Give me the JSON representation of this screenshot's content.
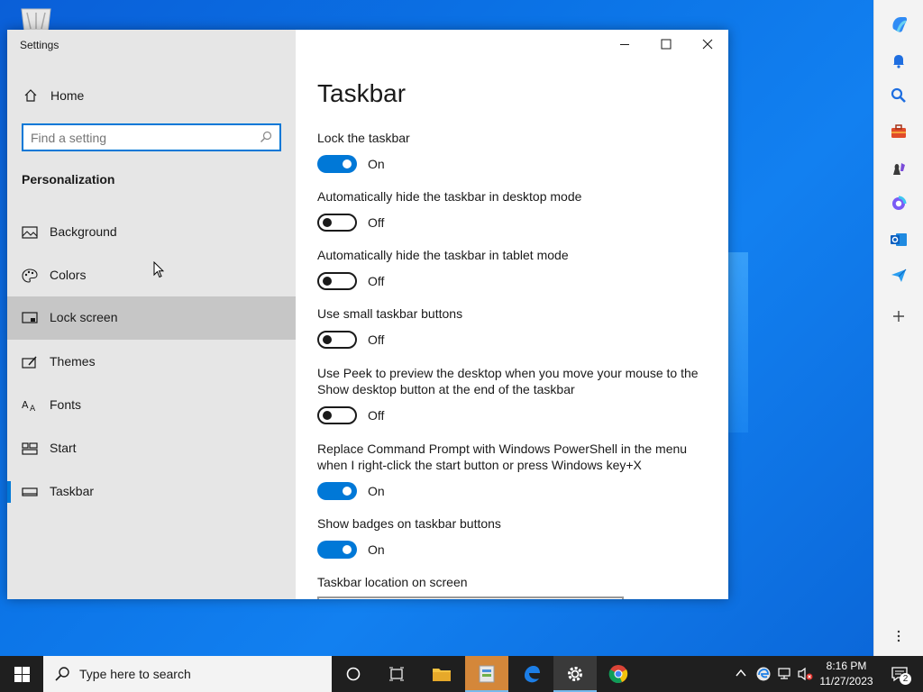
{
  "window": {
    "title": "Settings"
  },
  "nav": {
    "home_label": "Home",
    "search_placeholder": "Find a setting",
    "section_heading": "Personalization",
    "items": [
      {
        "label": "Background",
        "icon": "image-icon"
      },
      {
        "label": "Colors",
        "icon": "palette-icon"
      },
      {
        "label": "Lock screen",
        "icon": "lock-screen-icon"
      },
      {
        "label": "Themes",
        "icon": "themes-icon"
      },
      {
        "label": "Fonts",
        "icon": "fonts-icon"
      },
      {
        "label": "Start",
        "icon": "start-icon"
      },
      {
        "label": "Taskbar",
        "icon": "taskbar-icon"
      }
    ],
    "hovered_item": "Lock screen",
    "selected_item": "Taskbar"
  },
  "content": {
    "title": "Taskbar",
    "settings": [
      {
        "desc": "Lock the taskbar",
        "state": "On"
      },
      {
        "desc": "Automatically hide the taskbar in desktop mode",
        "state": "Off"
      },
      {
        "desc": "Automatically hide the taskbar in tablet mode",
        "state": "Off"
      },
      {
        "desc": "Use small taskbar buttons",
        "state": "Off"
      },
      {
        "desc": "Use Peek to preview the desktop when you move your mouse to the Show desktop button at the end of the taskbar",
        "state": "Off"
      },
      {
        "desc": "Replace Command Prompt with Windows PowerShell in the menu when I right-click the start button or press Windows key+X",
        "state": "On"
      },
      {
        "desc": "Show badges on taskbar buttons",
        "state": "On"
      }
    ],
    "location_label": "Taskbar location on screen"
  },
  "taskbar": {
    "search_text": "Type here to search",
    "time": "8:16 PM",
    "date": "11/27/2023",
    "notification_count": "2"
  },
  "colors": {
    "accent": "#0078d7",
    "desktop": "#0b73e6"
  }
}
